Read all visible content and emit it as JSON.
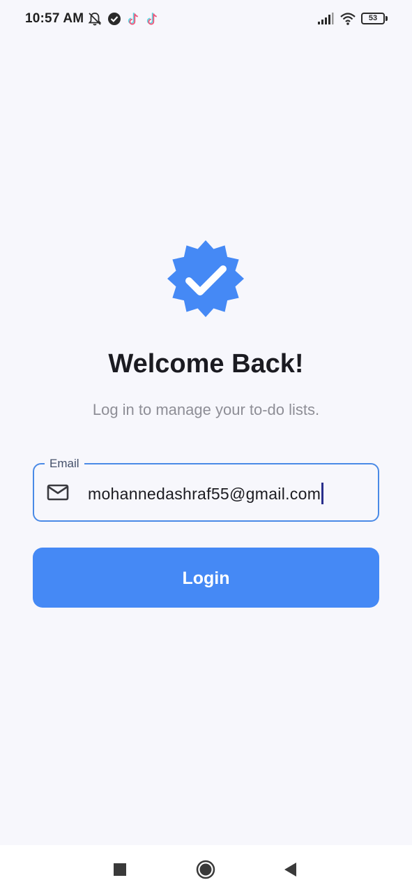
{
  "status_bar": {
    "time": "10:57 AM",
    "battery": "53",
    "icons": [
      "mute-bell-icon",
      "check-circle-icon",
      "tiktok-icon",
      "tiktok-icon",
      "signal-icon",
      "wifi-icon",
      "battery-icon"
    ]
  },
  "main": {
    "badge_icon": "verified-badge-icon",
    "title": "Welcome Back!",
    "subtitle": "Log in to manage your to-do lists."
  },
  "email_field": {
    "label": "Email",
    "value": "mohannedashraf55@gmail.com",
    "icon": "mail-icon"
  },
  "login_button": {
    "label": "Login"
  },
  "colors": {
    "accent": "#4589f5",
    "field_border": "#4a8ae6",
    "background": "#f7f7fc"
  },
  "nav_bar": {
    "icons": [
      "recents-square-icon",
      "home-circle-icon",
      "back-triangle-icon"
    ]
  }
}
